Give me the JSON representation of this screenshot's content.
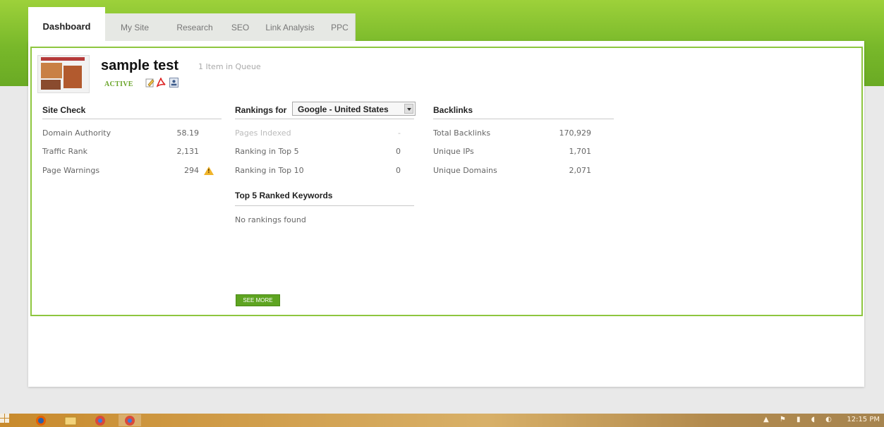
{
  "tabs": [
    "Dashboard",
    "My Site",
    "Research",
    "SEO",
    "Link Analysis",
    "PPC"
  ],
  "site": {
    "title": "sample test",
    "queue": "1 Item in Queue",
    "status": "ACTIVE"
  },
  "site_check": {
    "heading": "Site Check",
    "rows": [
      {
        "label": "Domain Authority",
        "value": "58.19"
      },
      {
        "label": "Traffic Rank",
        "value": "2,131"
      },
      {
        "label": "Page Warnings",
        "value": "294"
      }
    ]
  },
  "rankings": {
    "label": "Rankings for",
    "selected": "Google - United States",
    "rows": [
      {
        "label": "Pages Indexed",
        "value": "-"
      },
      {
        "label": "Ranking in Top 5",
        "value": "0"
      },
      {
        "label": "Ranking in Top 10",
        "value": "0"
      }
    ],
    "keywords_heading": "Top 5 Ranked Keywords",
    "keywords_empty": "No rankings found",
    "see_more": "SEE MORE"
  },
  "backlinks": {
    "heading": "Backlinks",
    "rows": [
      {
        "label": "Total Backlinks",
        "value": "170,929"
      },
      {
        "label": "Unique IPs",
        "value": "1,701"
      },
      {
        "label": "Unique Domains",
        "value": "2,071"
      }
    ]
  },
  "icons": {
    "edit": "edit-icon",
    "pdf": "pdf-icon",
    "image": "image-icon",
    "warning": "warning-icon"
  },
  "taskbar": {
    "time": "12:15 PM"
  },
  "colors": {
    "accent": "#8ec63f",
    "active": "#6aa52a",
    "button": "#5ea421"
  }
}
